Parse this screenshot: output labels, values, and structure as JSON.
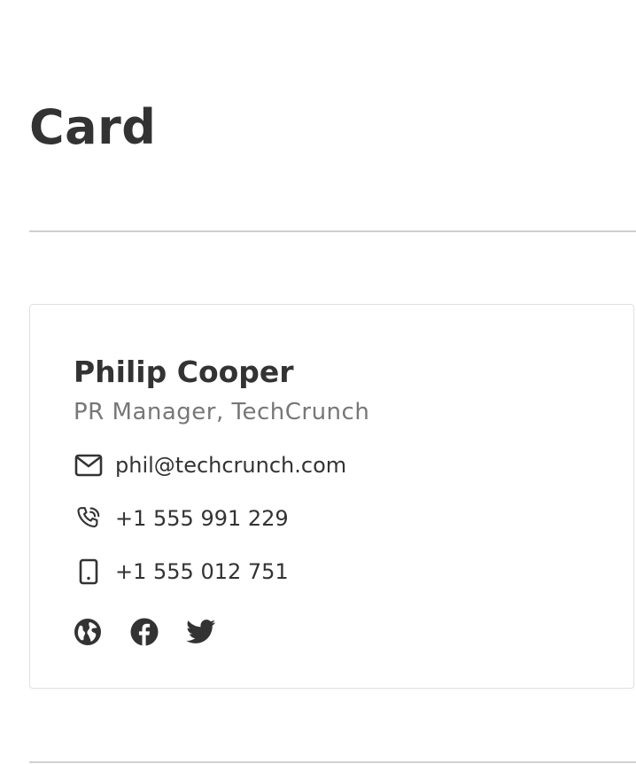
{
  "page": {
    "title": "Card"
  },
  "card": {
    "name": "Philip Cooper",
    "role": "PR Manager, TechCrunch",
    "email": "phil@techcrunch.com",
    "phone": "+1 555 991 229",
    "mobile": "+1 555 012 751",
    "icons": {
      "email": "envelope-icon",
      "phone": "phone-ringing-icon",
      "mobile": "mobile-phone-icon"
    },
    "socials": [
      {
        "icon": "globe-icon"
      },
      {
        "icon": "facebook-icon"
      },
      {
        "icon": "twitter-icon"
      }
    ]
  },
  "colors": {
    "text": "#333333",
    "muted": "#777777",
    "divider": "#d0d0d0",
    "card_border": "#e2e2e2"
  }
}
